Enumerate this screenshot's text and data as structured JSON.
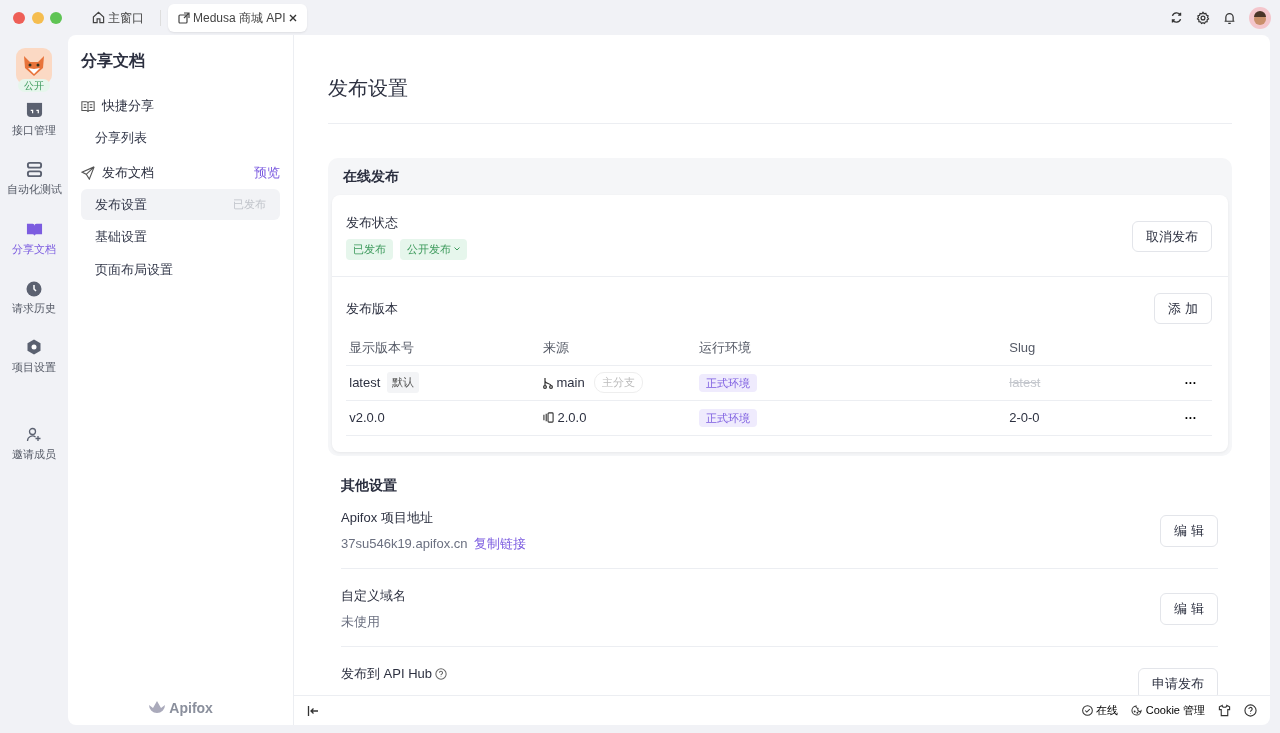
{
  "window": {
    "tabs": [
      {
        "label": "主窗口",
        "selected": false,
        "kind": "home"
      },
      {
        "label": "Medusa 商城 API",
        "selected": true,
        "kind": "doc"
      }
    ]
  },
  "project": {
    "badge": "公开"
  },
  "rail": [
    {
      "label": "接口管理",
      "selected": false
    },
    {
      "label": "自动化测试",
      "selected": false
    },
    {
      "label": "分享文档",
      "selected": true
    },
    {
      "label": "请求历史",
      "selected": false
    },
    {
      "label": "项目设置",
      "selected": false
    },
    {
      "label": "邀请成员",
      "selected": false
    }
  ],
  "sidebar": {
    "title": "分享文档",
    "items": [
      {
        "label": "快捷分享",
        "children": [
          {
            "label": "分享列表",
            "selected": false
          }
        ]
      },
      {
        "label": "发布文档",
        "action": "预览",
        "children": [
          {
            "label": "发布设置",
            "selected": true,
            "status": "已发布"
          },
          {
            "label": "基础设置",
            "selected": false
          },
          {
            "label": "页面布局设置",
            "selected": false
          }
        ]
      }
    ],
    "logo": "Apifox"
  },
  "page": {
    "title": "发布设置",
    "online": {
      "title": "在线发布",
      "status_label": "发布状态",
      "status_tags": [
        {
          "label": "已发布",
          "dropdown": false
        },
        {
          "label": "公开发布",
          "dropdown": true
        }
      ],
      "unpublish_button": "取消发布",
      "versions_label": "发布版本",
      "add_button": "添 加",
      "table": {
        "columns": [
          "显示版本号",
          "来源",
          "运行环境",
          "Slug"
        ],
        "rows": [
          {
            "version": "latest",
            "version_tag": "默认",
            "kind": "branch",
            "source": "main",
            "source_tag": "主分支",
            "env": "正式环境",
            "slug": "latest",
            "slug_disabled": true,
            "menu": "···"
          },
          {
            "version": "v2.0.0",
            "kind": "release",
            "source": "2.0.0",
            "env": "正式环境",
            "slug": "2-0-0",
            "slug_disabled": false,
            "menu": "···"
          }
        ]
      }
    },
    "other": {
      "title": "其他设置",
      "items": [
        {
          "label": "Apifox 项目地址",
          "value": "37su546k19.apifox.cn",
          "link": "复制链接",
          "help": false,
          "button": "编 辑"
        },
        {
          "label": "自定义域名",
          "value": "未使用",
          "help": false,
          "button": "编 辑"
        },
        {
          "label": "发布到 API Hub",
          "help": true,
          "button": "申请发布"
        }
      ]
    }
  },
  "status_bar": {
    "items": [
      {
        "label": "在线"
      },
      {
        "label": "Cookie 管理"
      }
    ]
  }
}
